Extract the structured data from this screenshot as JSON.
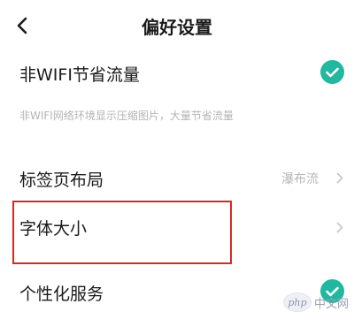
{
  "header": {
    "back_icon": "chevron-left-icon",
    "title": "偏好设置"
  },
  "rows": {
    "data_saver": {
      "title": "非WIFI节省流量",
      "description": "非WIFI网络环境显示压缩图片，大量节省流量",
      "checked": true
    },
    "tab_layout": {
      "title": "标签页布局",
      "value": "瀑布流"
    },
    "font_size": {
      "title": "字体大小",
      "highlighted": true
    },
    "personalization": {
      "title": "个性化服务",
      "checked": true
    }
  },
  "colors": {
    "accent": "#22b7a0",
    "highlight_border": "#d42b23",
    "muted_text": "#b4b4b4"
  },
  "watermark": {
    "logo": "php",
    "text": "中文网"
  }
}
